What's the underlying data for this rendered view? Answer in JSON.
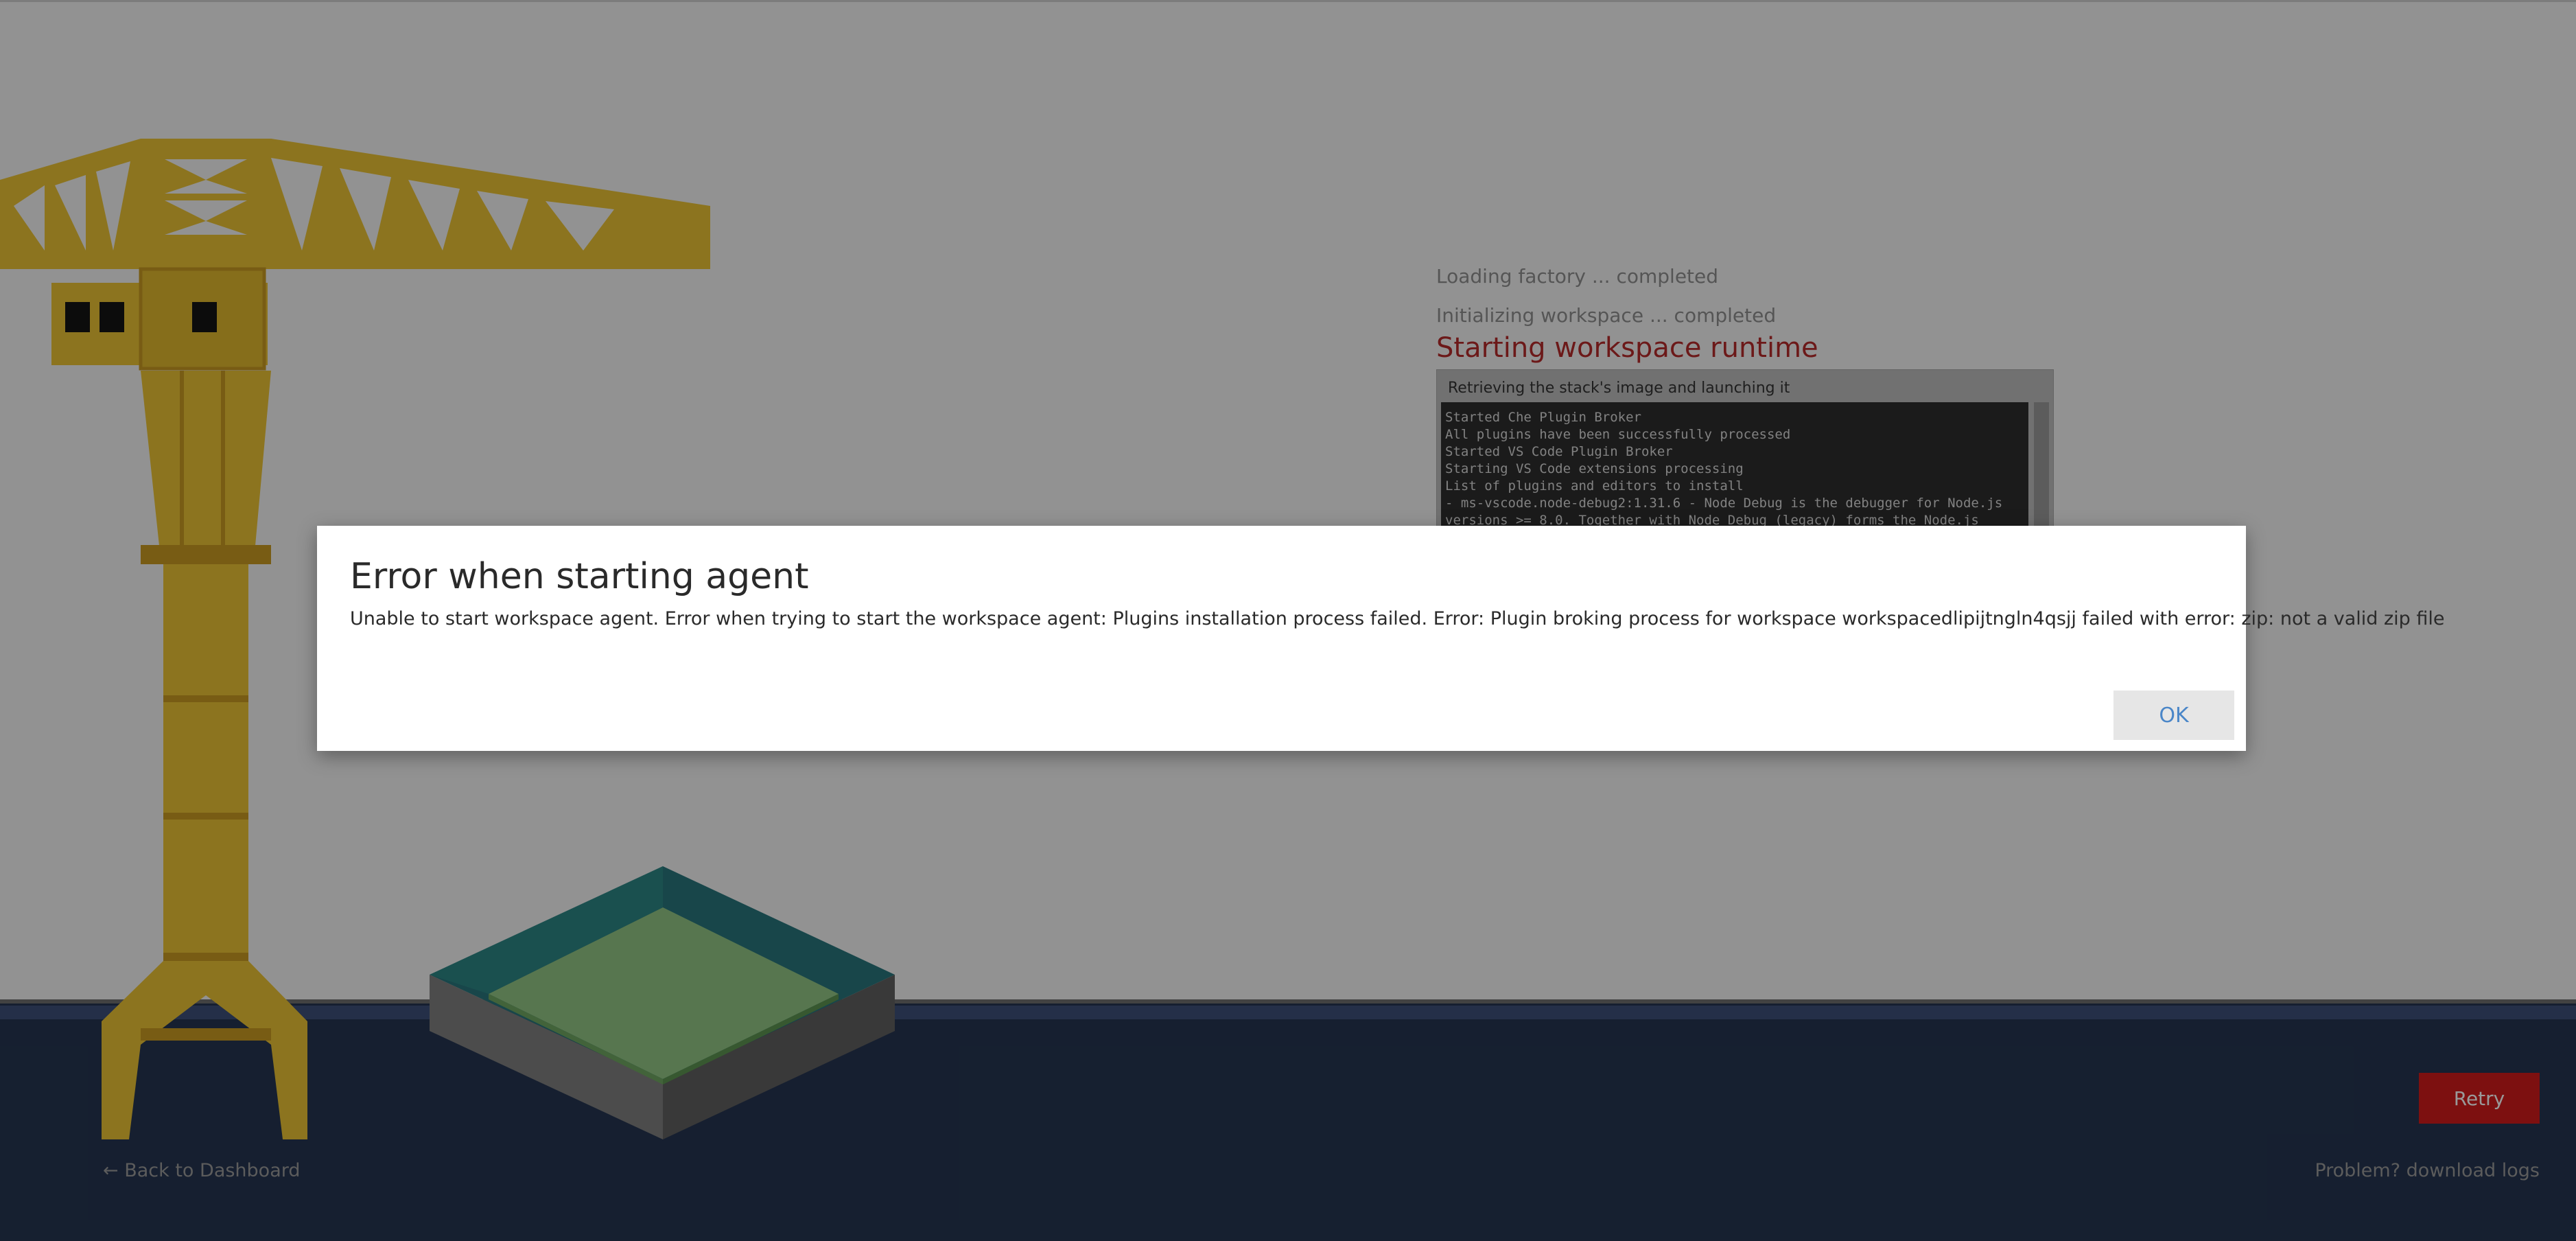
{
  "progress": {
    "completed_steps": [
      "Loading factory ... completed",
      "Initializing workspace ... completed"
    ],
    "current_step": "Starting workspace runtime",
    "log_panel": {
      "header": "Retrieving the stack's image and launching it",
      "lines": [
        "Started Che Plugin Broker",
        "All plugins have been successfully processed",
        "Started VS Code Plugin Broker",
        "Starting VS Code extensions processing",
        "List of plugins and editors to install",
        "- ms-vscode.node-debug2:1.31.6 - Node Debug is the debugger for Node.js",
        "versions >= 8.0. Together with Node Debug (legacy) forms the Node.js"
      ]
    }
  },
  "footer": {
    "retry_label": "Retry",
    "back_label": "← Back to Dashboard",
    "logs_label": "Problem? download logs"
  },
  "dialog": {
    "title": "Error when starting agent",
    "message": "Unable to start workspace agent. Error when trying to start the workspace agent: Plugins installation process failed. Error: Plugin broking process for workspace workspacedlipijtngln4qsjj failed with error: zip: not a valid zip file",
    "ok_label": "OK"
  },
  "colors": {
    "accent_red": "#d01b1b",
    "step_red": "#b52a2a",
    "ok_blue": "#4a86c8",
    "crane_yellow": "#e9c234",
    "floor_navy": "#253550"
  },
  "icons": {
    "back": "left-arrow-icon"
  }
}
